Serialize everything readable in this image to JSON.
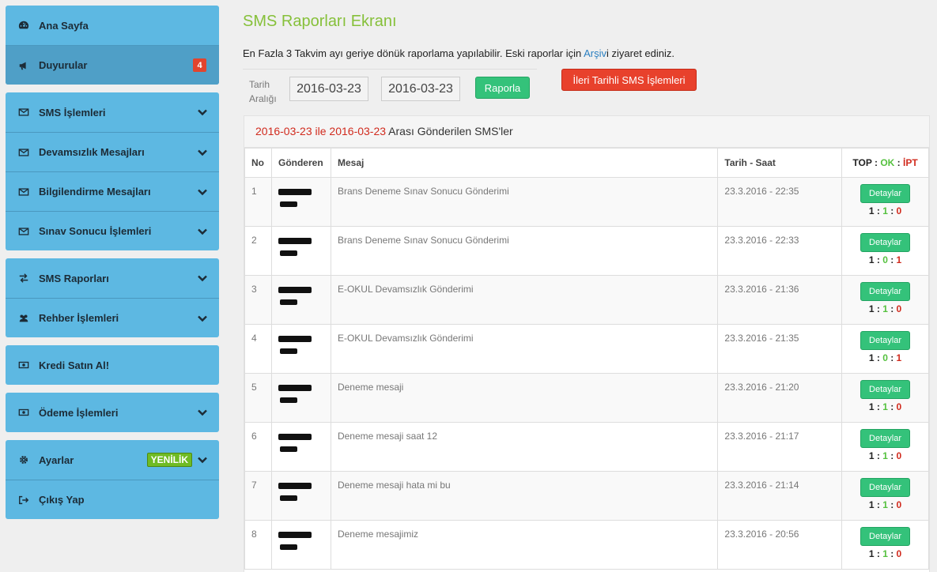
{
  "sidebar": {
    "groups": [
      {
        "items": [
          {
            "label": "Ana Sayfa",
            "icon": "dashboard-icon"
          },
          {
            "label": "Duyurular",
            "icon": "megaphone-icon",
            "badge": "4"
          }
        ]
      },
      {
        "items": [
          {
            "label": "SMS İşlemleri",
            "icon": "envelope-icon"
          },
          {
            "label": "Devamsızlık Mesajları",
            "icon": "envelope-icon"
          },
          {
            "label": "Bilgilendirme Mesajları",
            "icon": "envelope-icon"
          },
          {
            "label": "Sınav Sonucu İşlemleri",
            "icon": "envelope-icon"
          }
        ]
      },
      {
        "items": [
          {
            "label": "SMS Raporları",
            "icon": "exchange-icon"
          },
          {
            "label": "Rehber İşlemleri",
            "icon": "users-icon"
          }
        ]
      },
      {
        "items": [
          {
            "label": "Kredi Satın Al!",
            "icon": "money-icon"
          }
        ]
      },
      {
        "items": [
          {
            "label": "Ödeme İşlemleri",
            "icon": "money-icon"
          }
        ]
      },
      {
        "items": [
          {
            "label": "Ayarlar",
            "icon": "gear-icon",
            "badge": "YENİLİK"
          },
          {
            "label": "Çıkış Yap",
            "icon": "sign-out-icon"
          }
        ]
      }
    ]
  },
  "main": {
    "title": "SMS Raporları Ekranı",
    "info_prefix": "En Fazla 3 Takvim ayı geriye dönük raporlama yapılabilir. Eski raporlar için ",
    "info_link": "Arşiv",
    "info_suffix": "i ziyaret ediniz.",
    "filter_label_1": "Tarih",
    "filter_label_2": "Aralığı",
    "date_from": "2016-03-23",
    "date_to": "2016-03-23",
    "report_button": "Raporla",
    "future_button": "İleri Tarihli SMS İşlemleri",
    "panel": {
      "date_from": "2016-03-23",
      "mid": " ile ",
      "date_to": "2016-03-23",
      "suffix": " Arası Gönderilen SMS'ler"
    },
    "table": {
      "headers": {
        "no": "No",
        "sender": "Gönderen",
        "message": "Mesaj",
        "datetime": "Tarih - Saat",
        "top": "TOP",
        "ok": "OK",
        "ipt": "İPT",
        "sep": " : "
      },
      "detail_label": "Detaylar",
      "rows": [
        {
          "no": "1",
          "message": "Brans Deneme Sınav Sonucu Gönderimi",
          "datetime": "23.3.2016 - 22:35",
          "top": "1",
          "ok": "1",
          "ipt": "0"
        },
        {
          "no": "2",
          "message": "Brans Deneme Sınav Sonucu Gönderimi",
          "datetime": "23.3.2016 - 22:33",
          "top": "1",
          "ok": "0",
          "ipt": "1"
        },
        {
          "no": "3",
          "message": "E-OKUL Devamsızlık Gönderimi",
          "datetime": "23.3.2016 - 21:36",
          "top": "1",
          "ok": "1",
          "ipt": "0"
        },
        {
          "no": "4",
          "message": "E-OKUL Devamsızlık Gönderimi",
          "datetime": "23.3.2016 - 21:35",
          "top": "1",
          "ok": "0",
          "ipt": "1"
        },
        {
          "no": "5",
          "message": "Deneme mesaji",
          "datetime": "23.3.2016 - 21:20",
          "top": "1",
          "ok": "1",
          "ipt": "0"
        },
        {
          "no": "6",
          "message": "Deneme mesaji saat 12",
          "datetime": "23.3.2016 - 21:17",
          "top": "1",
          "ok": "1",
          "ipt": "0"
        },
        {
          "no": "7",
          "message": "Deneme mesaji hata mi bu",
          "datetime": "23.3.2016 - 21:14",
          "top": "1",
          "ok": "1",
          "ipt": "0"
        },
        {
          "no": "8",
          "message": "Deneme mesajimiz",
          "datetime": "23.3.2016 - 20:56",
          "top": "1",
          "ok": "1",
          "ipt": "0"
        }
      ]
    }
  }
}
